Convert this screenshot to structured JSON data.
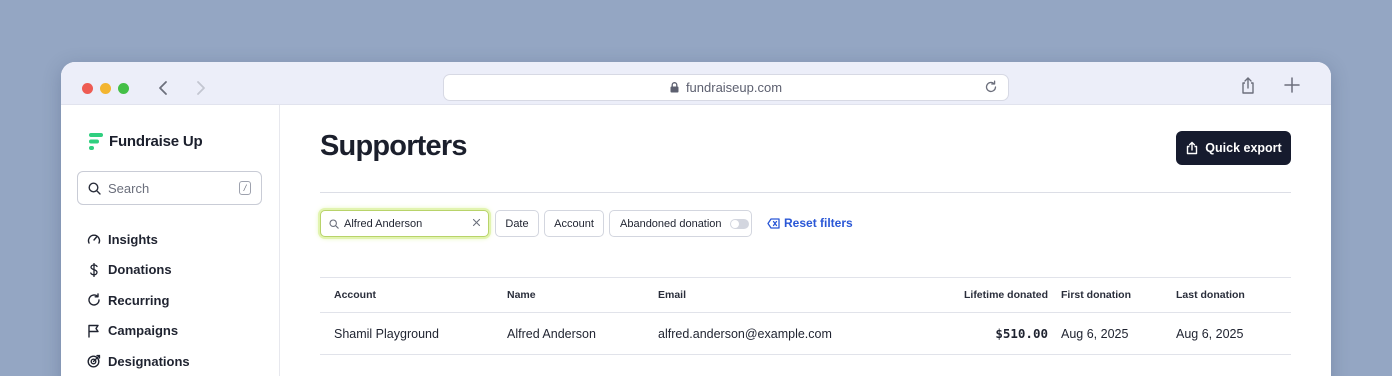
{
  "browser": {
    "url": "fundraiseup.com"
  },
  "brand": {
    "name": "Fundraise Up",
    "accent": "#2fcf7f"
  },
  "sidebar": {
    "search_placeholder": "Search",
    "search_shortcut": "/",
    "items": [
      {
        "label": "Insights",
        "icon": "gauge-icon"
      },
      {
        "label": "Donations",
        "icon": "dollar-icon"
      },
      {
        "label": "Recurring",
        "icon": "recurring-icon"
      },
      {
        "label": "Campaigns",
        "icon": "flag-icon"
      },
      {
        "label": "Designations",
        "icon": "target-icon"
      }
    ]
  },
  "main": {
    "title": "Supporters",
    "export_label": "Quick export",
    "filters": {
      "search_value": "Alfred Anderson",
      "date_label": "Date",
      "account_label": "Account",
      "abandoned_label": "Abandoned donation",
      "abandoned_on": false,
      "reset_label": "Reset filters"
    },
    "table": {
      "headers": {
        "account": "Account",
        "name": "Name",
        "email": "Email",
        "lifetime": "Lifetime donated",
        "first": "First donation",
        "last": "Last donation"
      },
      "rows": [
        {
          "account": "Shamil Playground",
          "name": "Alfred Anderson",
          "email": "alfred.anderson@example.com",
          "lifetime": "$510.00",
          "first": "Aug 6, 2025",
          "last": "Aug 6, 2025"
        }
      ]
    }
  }
}
